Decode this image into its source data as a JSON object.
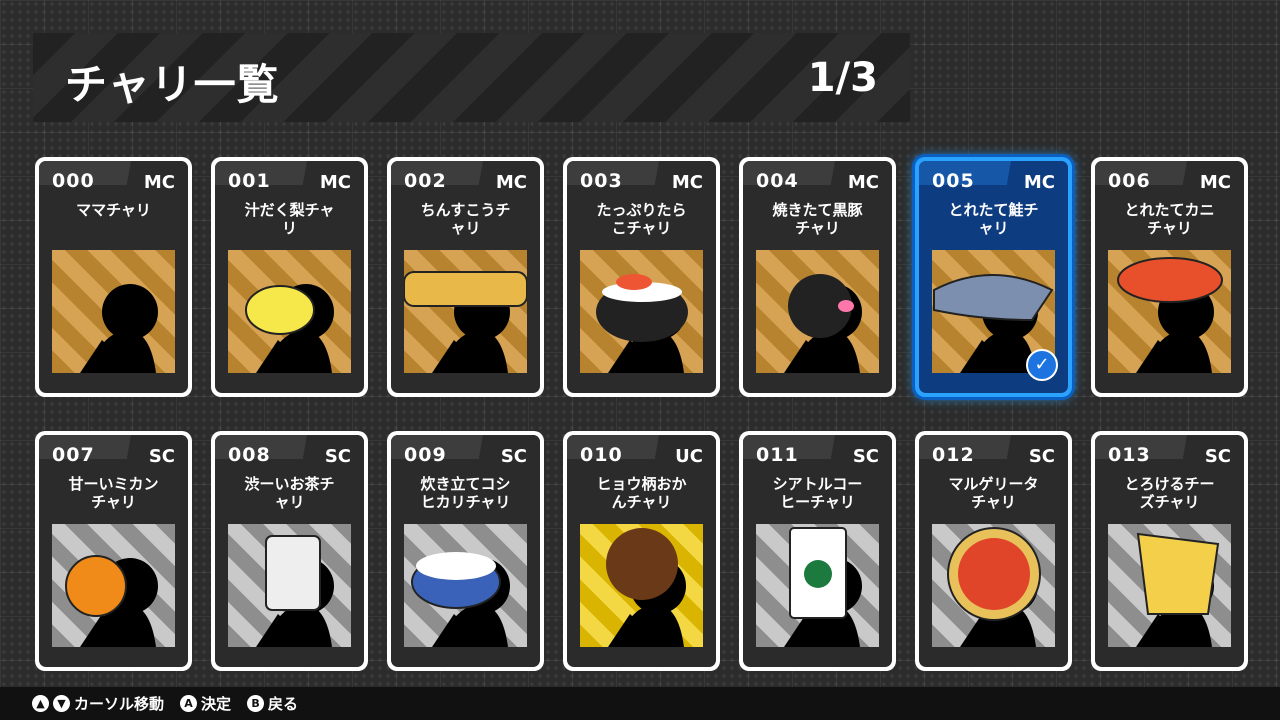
{
  "header": {
    "title": "チャリ一覧",
    "page_indicator": "1/3"
  },
  "cards": [
    {
      "id": "000",
      "rarity": "MC",
      "name": "ママチャリ",
      "theme": "bronze",
      "icon": "plain-silhouette"
    },
    {
      "id": "001",
      "rarity": "MC",
      "name": "汁だく梨チャ\nリ",
      "theme": "bronze",
      "icon": "pear-head"
    },
    {
      "id": "002",
      "rarity": "MC",
      "name": "ちんすこうチ\nャリ",
      "theme": "bronze",
      "icon": "chinsuko-head"
    },
    {
      "id": "003",
      "rarity": "MC",
      "name": "たっぷりたら\nこチャリ",
      "theme": "bronze",
      "icon": "tarako-bowl-head"
    },
    {
      "id": "004",
      "rarity": "MC",
      "name": "焼きたて黒豚\nチャリ",
      "theme": "bronze",
      "icon": "black-pig-head"
    },
    {
      "id": "005",
      "rarity": "MC",
      "name": "とれたて鮭チ\nャリ",
      "theme": "bronze",
      "icon": "salmon-head",
      "selected": true
    },
    {
      "id": "006",
      "rarity": "MC",
      "name": "とれたてカニ\nチャリ",
      "theme": "bronze",
      "icon": "crab-head"
    },
    {
      "id": "007",
      "rarity": "SC",
      "name": "甘ーいミカン\nチャリ",
      "theme": "silver",
      "icon": "mikan-head"
    },
    {
      "id": "008",
      "rarity": "SC",
      "name": "渋ーいお茶チ\nャリ",
      "theme": "silver",
      "icon": "tea-cup-head"
    },
    {
      "id": "009",
      "rarity": "SC",
      "name": "炊き立てコシ\nヒカリチャリ",
      "theme": "silver",
      "icon": "rice-bowl-head"
    },
    {
      "id": "010",
      "rarity": "UC",
      "name": "ヒョウ柄おか\nんチャリ",
      "theme": "gold",
      "icon": "leopard-lady-head"
    },
    {
      "id": "011",
      "rarity": "SC",
      "name": "シアトルコー\nヒーチャリ",
      "theme": "silver",
      "icon": "coffee-cup-head"
    },
    {
      "id": "012",
      "rarity": "SC",
      "name": "マルゲリータ\nチャリ",
      "theme": "silver",
      "icon": "pizza-head"
    },
    {
      "id": "013",
      "rarity": "SC",
      "name": "とろけるチー\nズチャリ",
      "theme": "silver",
      "icon": "cheese-head"
    }
  ],
  "footer": {
    "cursor_label": "カーソル移動",
    "confirm_button": "A",
    "confirm_label": "決定",
    "back_button": "B",
    "back_label": "戻る"
  },
  "colors": {
    "selected": "#29a3ff",
    "bronze": "#c99342",
    "silver": "#b0b0b0",
    "gold": "#e8c41a"
  }
}
